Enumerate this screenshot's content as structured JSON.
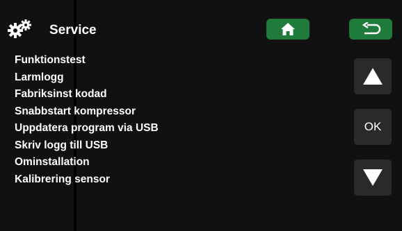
{
  "header": {
    "title": "Service",
    "icon": "gears-icon",
    "home_icon": "home-icon",
    "back_icon": "back-arrow-icon"
  },
  "menu": {
    "items": [
      {
        "label": "Funktionstest"
      },
      {
        "label": "Larmlogg"
      },
      {
        "label": "Fabriksinst kodad"
      },
      {
        "label": "Snabbstart kompressor"
      },
      {
        "label": "Uppdatera program via USB"
      },
      {
        "label": "Skriv logg till USB"
      },
      {
        "label": "Ominstallation"
      },
      {
        "label": "Kalibrering sensor"
      }
    ]
  },
  "side_buttons": {
    "up_icon": "triangle-up-icon",
    "ok_label": "OK",
    "down_icon": "triangle-down-icon"
  },
  "colors": {
    "background": "#111111",
    "accent": "#1e7b3c",
    "side_button": "#2a2a2a",
    "text": "#ffffff"
  }
}
